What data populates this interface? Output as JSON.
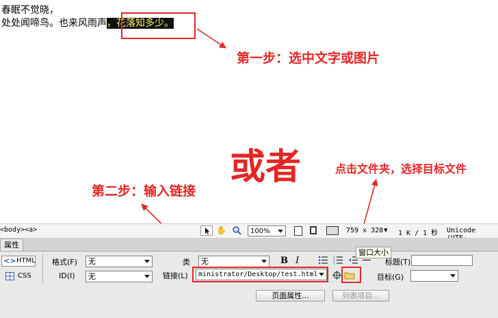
{
  "document": {
    "line1": "春眠不觉晓，",
    "line2_plain": "处处闻啼鸟。也来风雨声",
    "line2_selected": "，花落知多少。"
  },
  "annotations": {
    "step1": "第一步：选中文字或图片",
    "or": "或者",
    "step2": "第二步：输入链接",
    "click_folder": "点击文件夹，选择目标文件"
  },
  "statusbar": {
    "tags": "<body><a>",
    "zoom": "100%",
    "dimensions": "759 x 328",
    "filesize": "1 K / 1 秒",
    "encoding": "Unicode (UTF-"
  },
  "panel": {
    "tab_label": "属性",
    "html_button": "HTML",
    "css_button": "CSS",
    "format_label": "格式(F)",
    "format_value": "无",
    "class_label": "类",
    "class_value": "无",
    "id_label": "ID(I)",
    "id_value": "无",
    "link_label": "链接(L)",
    "link_value": "ministrator/Desktop/test.html",
    "title_label": "标题(T)",
    "target_label": "目标(G)",
    "target_value": "",
    "page_props_button": "页面属性...",
    "list_items_button": "列表项目...",
    "tooltip": "窗口大小",
    "bold": "B",
    "italic": "I"
  },
  "colors": {
    "annotation_red": "#e52525",
    "selection_bg": "#111111",
    "selection_text": "#f5ef6a"
  }
}
